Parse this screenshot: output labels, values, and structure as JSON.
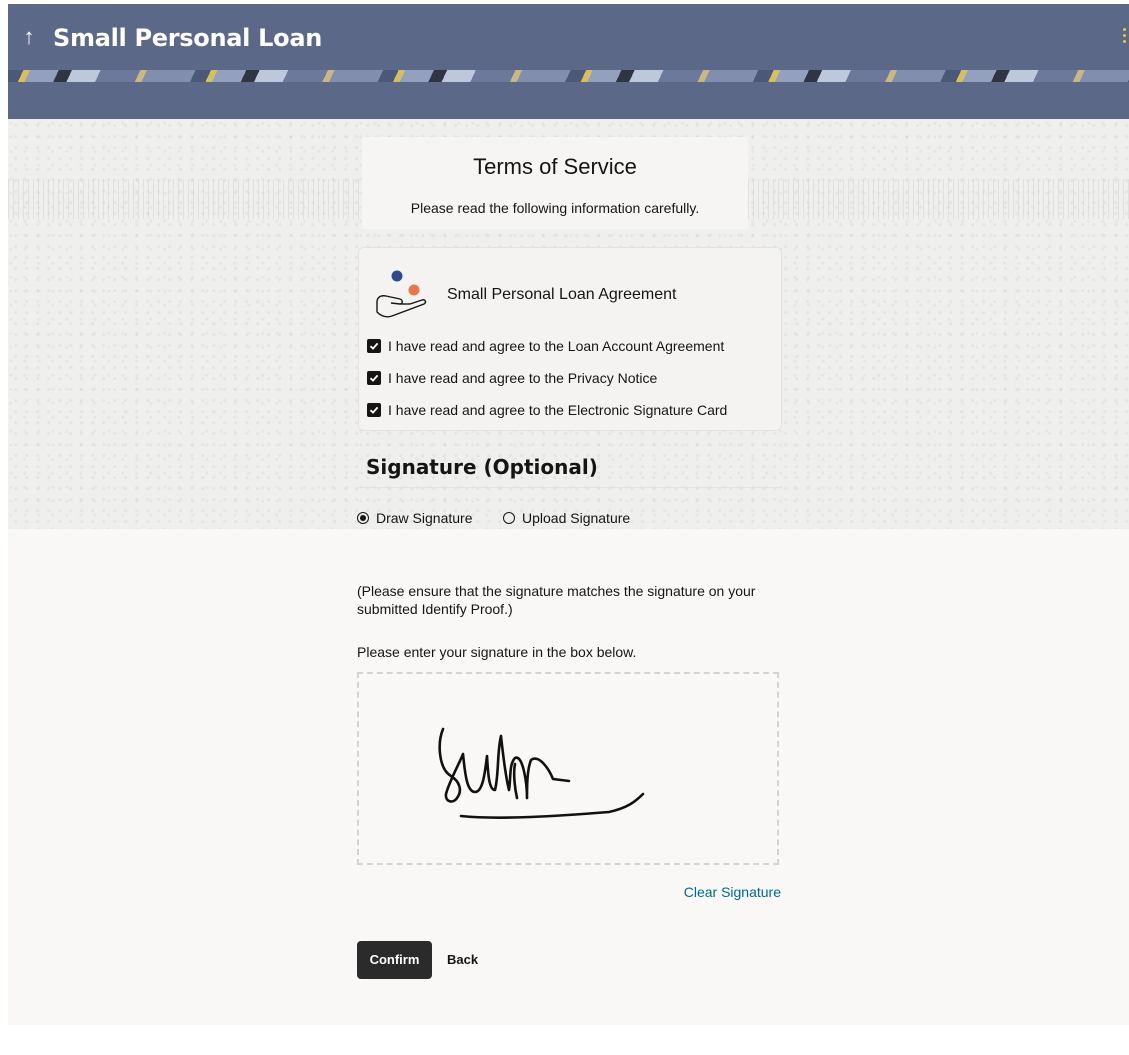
{
  "header": {
    "title": "Small Personal Loan",
    "back_icon": "arrow-up-icon",
    "menu_icon": "kebab-menu-icon",
    "background_color": "#5b6888"
  },
  "terms": {
    "title": "Terms of Service",
    "subtitle": "Please read the following information carefully."
  },
  "agreement": {
    "title": "Small Personal Loan Agreement",
    "icon": "hand-coins-icon",
    "items": [
      {
        "label": "I have read and agree to the Loan Account Agreement",
        "checked": true
      },
      {
        "label": "I have read and agree to the Privacy Notice",
        "checked": true
      },
      {
        "label": "I have read and agree to the Electronic Signature Card",
        "checked": true
      }
    ]
  },
  "signature": {
    "heading": "Signature (Optional)",
    "options": [
      {
        "label": "Draw Signature",
        "selected": true
      },
      {
        "label": "Upload Signature",
        "selected": false
      }
    ],
    "note": "(Please ensure that the signature matches the signature on your submitted Identify Proof.)",
    "instruction": "Please enter your signature in the box below.",
    "clear_label": "Clear Signature"
  },
  "actions": {
    "confirm_label": "Confirm",
    "back_label": "Back"
  },
  "colors": {
    "link": "#00688c",
    "primary_button": "#2b2b2b"
  }
}
